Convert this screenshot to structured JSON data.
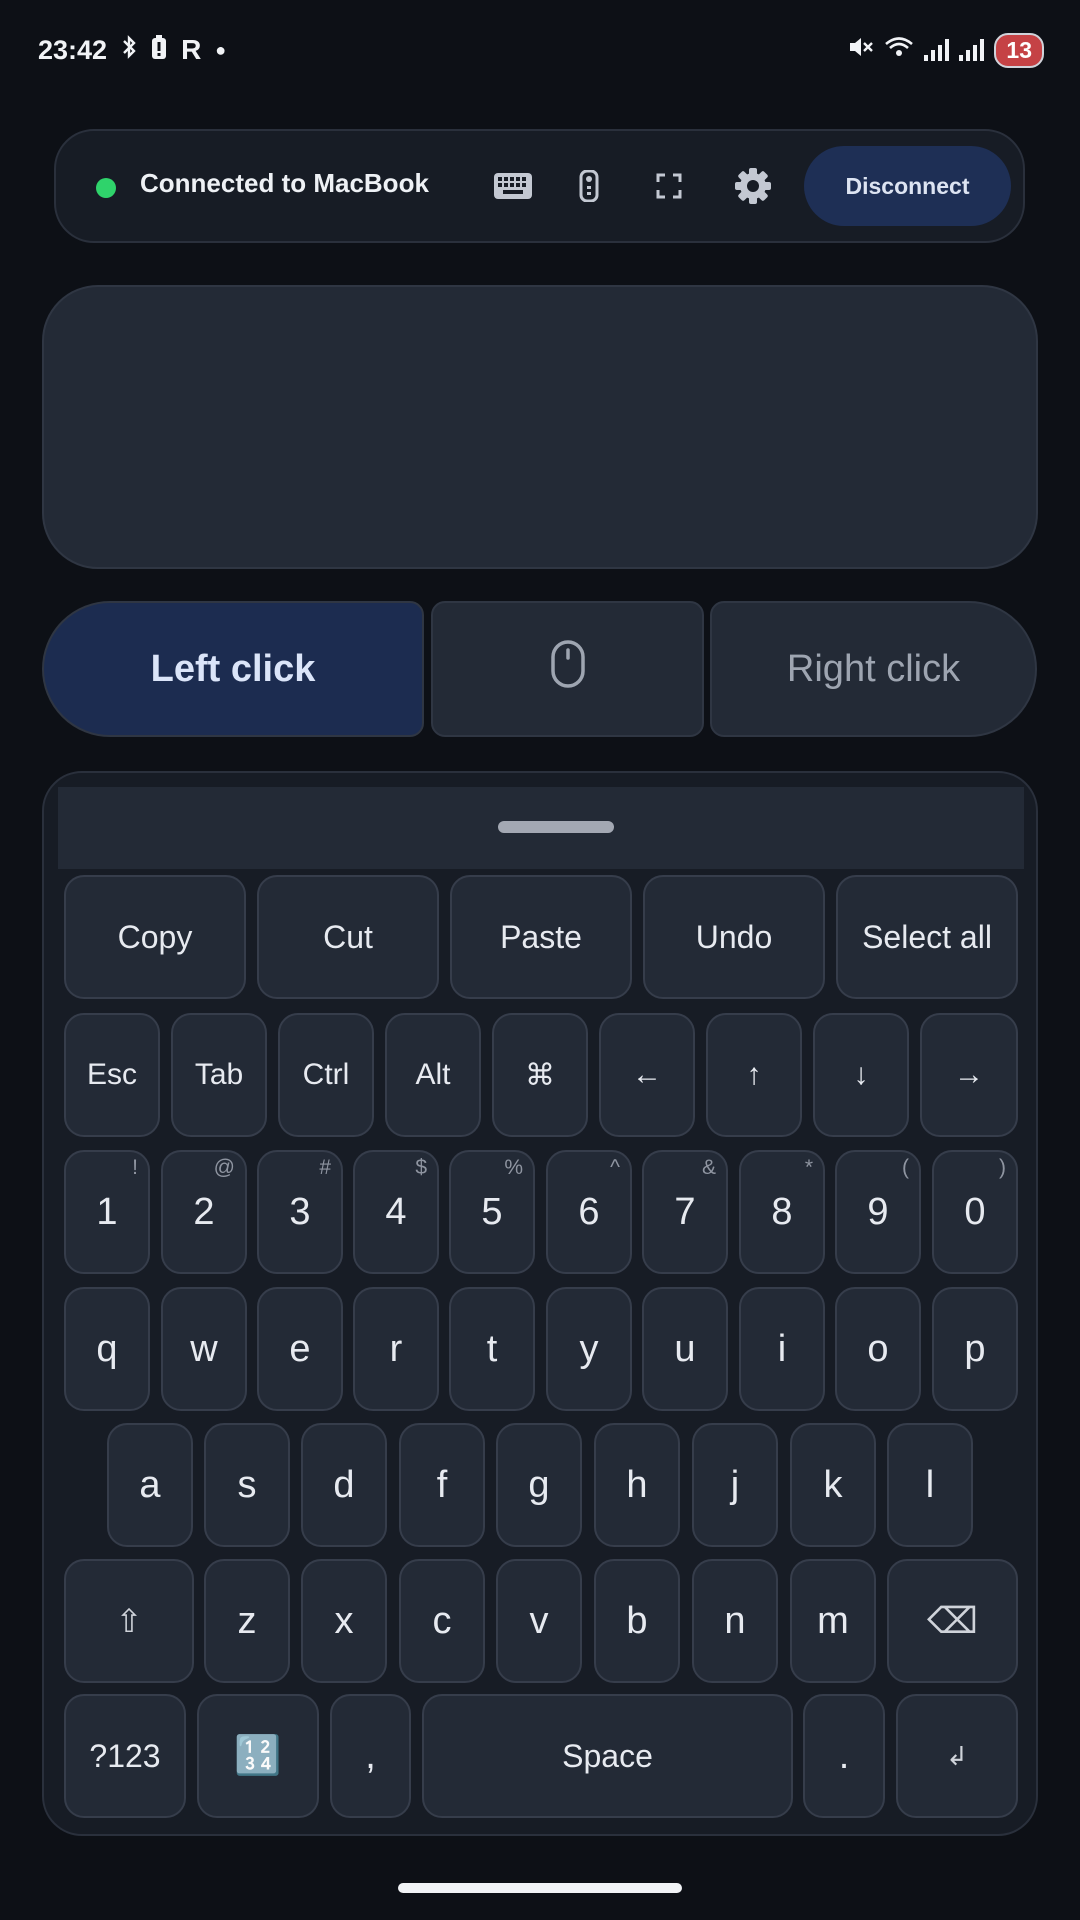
{
  "status_bar": {
    "time": "23:42",
    "icons_left": [
      "bluetooth-icon",
      "battery-saver-icon",
      "r-app-icon",
      "dot-icon"
    ],
    "icons_right": [
      "mute-icon",
      "wifi-icon",
      "signal-icon",
      "signal-icon"
    ],
    "battery": "13"
  },
  "connection": {
    "status_text": "Connected to MacBook",
    "status_color": "#2fd36b",
    "icons": [
      "keyboard-icon",
      "remote-icon",
      "fullscreen-icon",
      "settings-icon"
    ],
    "disconnect_label": "Disconnect"
  },
  "clicks": {
    "left": "Left click",
    "middle_icon": "mouse-icon",
    "right": "Right click"
  },
  "keyboard": {
    "shortcuts": [
      "Copy",
      "Cut",
      "Paste",
      "Undo",
      "Select all"
    ],
    "modifiers": [
      "Esc",
      "Tab",
      "Ctrl",
      "Alt",
      "⌘",
      "←",
      "↑",
      "↓",
      "→"
    ],
    "numbers": [
      {
        "main": "1",
        "alt": "!"
      },
      {
        "main": "2",
        "alt": "@"
      },
      {
        "main": "3",
        "alt": "#"
      },
      {
        "main": "4",
        "alt": "$"
      },
      {
        "main": "5",
        "alt": "%"
      },
      {
        "main": "6",
        "alt": "^"
      },
      {
        "main": "7",
        "alt": "&"
      },
      {
        "main": "8",
        "alt": "*"
      },
      {
        "main": "9",
        "alt": "("
      },
      {
        "main": "0",
        "alt": ")"
      }
    ],
    "row_q": [
      "q",
      "w",
      "e",
      "r",
      "t",
      "y",
      "u",
      "i",
      "o",
      "p"
    ],
    "row_a": [
      "a",
      "s",
      "d",
      "f",
      "g",
      "h",
      "j",
      "k",
      "l"
    ],
    "row_z": [
      "z",
      "x",
      "c",
      "v",
      "b",
      "n",
      "m"
    ],
    "shift": "⇧",
    "backspace": "⌫",
    "symbols": "?123",
    "numpad": "🔢",
    "comma": ",",
    "space": "Space",
    "period": ".",
    "enter": "↲"
  },
  "colors": {
    "background": "#0d1016",
    "surface": "#232a36",
    "accent": "#1e2f55"
  }
}
